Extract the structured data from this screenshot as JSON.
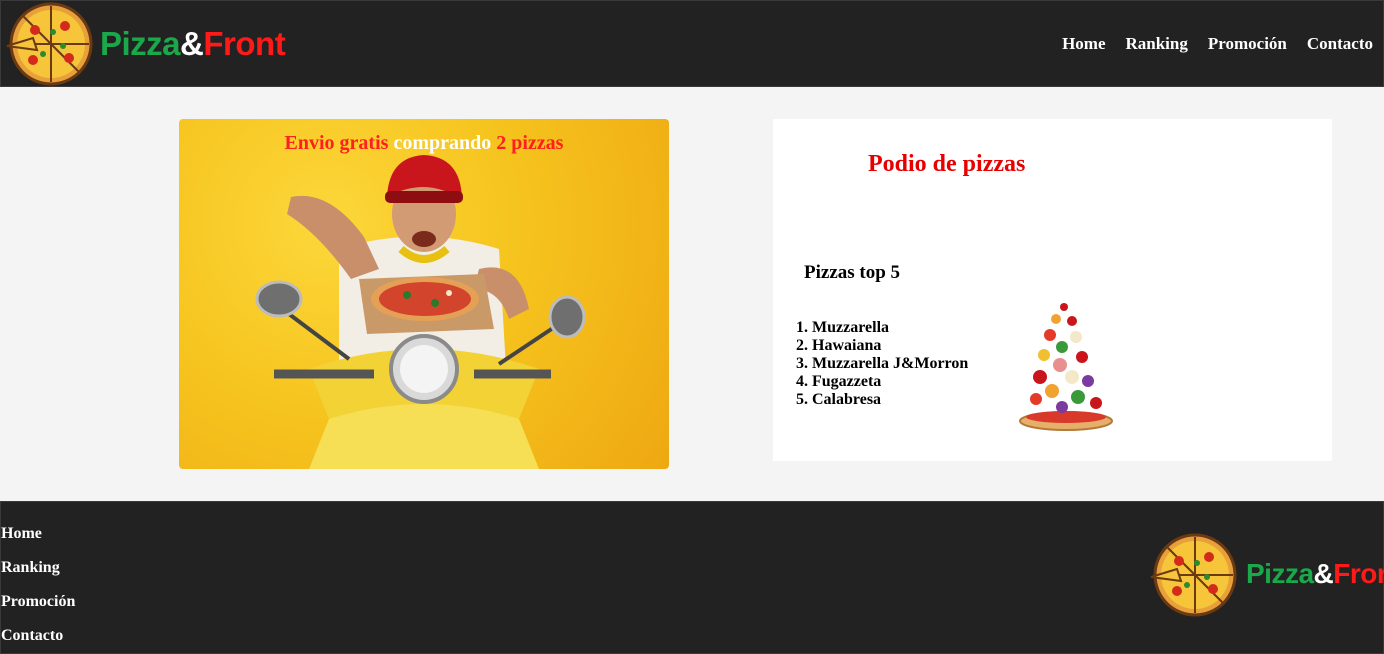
{
  "brand": {
    "name_part1": "Pizza",
    "name_amp": "&",
    "name_part2": "Front",
    "colors": {
      "green": "#1aa84a",
      "white": "#ffffff",
      "red": "#ff1a1a"
    }
  },
  "header": {
    "nav": [
      "Home",
      "Ranking",
      "Promoción",
      "Contacto"
    ]
  },
  "promo": {
    "title_part1": "Envio gratis",
    "title_part2": "comprando",
    "title_part3": "2 pizzas",
    "image_icon": "delivery-scooter-pizza-icon"
  },
  "podium": {
    "title": "Podio de pizzas",
    "list_title": "Pizzas top 5",
    "items": [
      "1. Muzzarella",
      "2. Hawaiana",
      "3. Muzzarella J&Morron",
      "4. Fugazzeta",
      "5. Calabresa"
    ],
    "image_icon": "pizza-ingredients-icon"
  },
  "footer": {
    "links": [
      "Home",
      "Ranking",
      "Promoción",
      "Contacto"
    ]
  },
  "theme": {
    "bar_background": "#222222",
    "page_background": "#f4f4f4",
    "accent_red": "#e60000",
    "promo_yellow": "#f6c41e"
  }
}
